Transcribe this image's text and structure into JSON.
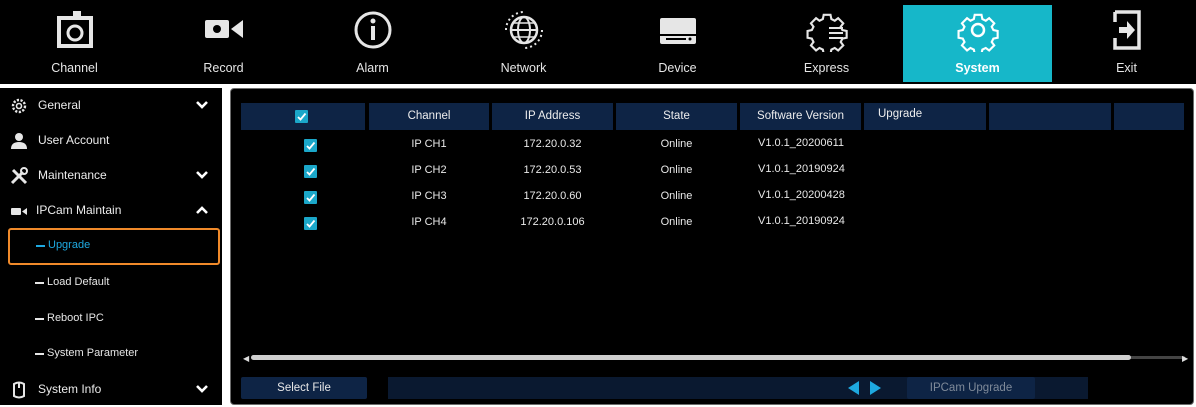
{
  "topbar": {
    "items": [
      {
        "label": "Channel",
        "icon": "channel-icon"
      },
      {
        "label": "Record",
        "icon": "record-camera-icon"
      },
      {
        "label": "Alarm",
        "icon": "alarm-info-icon"
      },
      {
        "label": "Network",
        "icon": "globe-icon"
      },
      {
        "label": "Device",
        "icon": "hard-drive-icon"
      },
      {
        "label": "Express",
        "icon": "express-gear-icon"
      },
      {
        "label": "System",
        "icon": "gear-icon",
        "active": true
      },
      {
        "label": "Exit",
        "icon": "exit-icon"
      }
    ],
    "active_color": "#16b7c9"
  },
  "sidebar": {
    "general": "General",
    "user_account": "User Account",
    "maintenance": "Maintenance",
    "ipcam_maintain": "IPCam Maintain",
    "sub": [
      "Upgrade",
      "Load Default",
      "Reboot IPC",
      "System Parameter"
    ],
    "system_info": "System Info",
    "selected": "Upgrade"
  },
  "table": {
    "headers": [
      "Channel",
      "IP Address",
      "State",
      "Software Version",
      "Upgrade"
    ],
    "header_all_checked": true,
    "rows": [
      {
        "checked": true,
        "channel": "IP CH1",
        "ip": "172.20.0.32",
        "state": "Online",
        "version": "V1.0.1_20200611"
      },
      {
        "checked": true,
        "channel": "IP CH2",
        "ip": "172.20.0.53",
        "state": "Online",
        "version": "V1.0.1_20190924"
      },
      {
        "checked": true,
        "channel": "IP CH3",
        "ip": "172.20.0.60",
        "state": "Online",
        "version": "V1.0.1_20200428"
      },
      {
        "checked": true,
        "channel": "IP CH4",
        "ip": "172.20.0.106",
        "state": "Online",
        "version": "V1.0.1_20190924"
      }
    ]
  },
  "bottom": {
    "select_file": "Select File",
    "file_path": "",
    "ipcam_upgrade": "IPCam Upgrade"
  },
  "colors": {
    "accent": "#16b7c9",
    "selection_border": "#f08a2a",
    "selected_text": "#1ea9e0",
    "header_bg": "#0e2445",
    "checkbox": "#1ba7c9"
  }
}
